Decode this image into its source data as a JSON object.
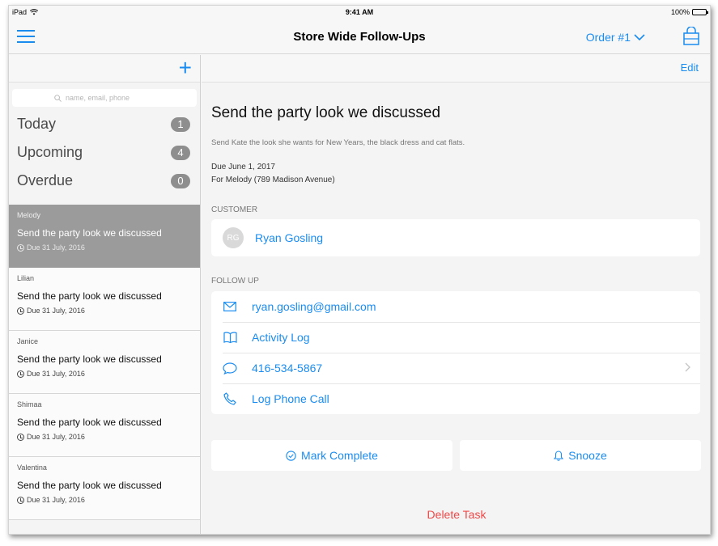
{
  "status_bar": {
    "device": "iPad",
    "time": "9:41 AM",
    "battery": "100%"
  },
  "nav": {
    "title": "Store Wide Follow-Ups",
    "order": "Order #1"
  },
  "sidebar": {
    "search_placeholder": "name, email, phone",
    "categories": [
      {
        "label": "Today",
        "count": "1"
      },
      {
        "label": "Upcoming",
        "count": "4"
      },
      {
        "label": "Overdue",
        "count": "0"
      }
    ],
    "tasks": [
      {
        "who": "Melody",
        "title": "Send the party look we discussed",
        "due": "Due 31 July, 2016"
      },
      {
        "who": "Lilian",
        "title": "Send the party look we discussed",
        "due": "Due 31 July, 2016"
      },
      {
        "who": "Janice",
        "title": "Send the party look we discussed",
        "due": "Due 31 July, 2016"
      },
      {
        "who": "Shimaa",
        "title": "Send the party look we discussed",
        "due": "Due 31 July, 2016"
      },
      {
        "who": "Valentina",
        "title": "Send the party look we discussed",
        "due": "Due 31 July, 2016"
      }
    ]
  },
  "detail": {
    "edit": "Edit",
    "title": "Send the party look we discussed",
    "description": "Send Kate the look she wants for New Years, the black dress and cat flats.",
    "due": "Due June 1, 2017",
    "for": "For Melody (789 Madison Avenue)",
    "customer_label": "CUSTOMER",
    "customer": {
      "initials": "RG",
      "name": "Ryan Gosling"
    },
    "followup_label": "FOLLOW UP",
    "followup": {
      "email": "ryan.gosling@gmail.com",
      "activity": "Activity Log",
      "phone": "416-534-5867",
      "log_call": "Log Phone Call"
    },
    "mark_complete": "Mark Complete",
    "snooze": "Snooze",
    "delete": "Delete Task"
  },
  "colors": {
    "accent": "#1a8cf0",
    "danger": "#f04848",
    "selected_row": "#9b9b9b"
  }
}
